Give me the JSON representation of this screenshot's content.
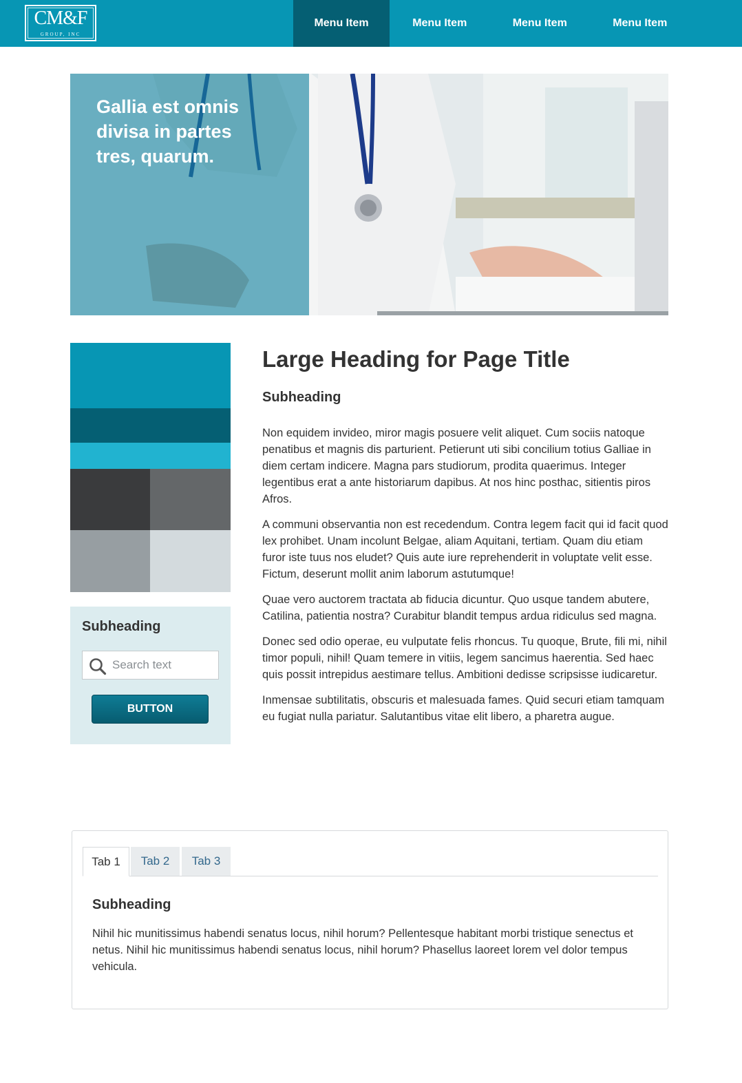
{
  "header": {
    "logo_main": "CM&F",
    "logo_sub": "GROUP, INC",
    "nav": [
      "Menu Item",
      "Menu Item",
      "Menu Item",
      "Menu Item"
    ]
  },
  "hero": {
    "headline": "Gallia est omnis divisa in partes tres, quarum."
  },
  "swatches": {
    "colors": [
      "#0796b4",
      "#055f73",
      "#21b3d0",
      "#3a3b3d",
      "#646769",
      "#979ea2",
      "#d3dadd"
    ]
  },
  "sidebar": {
    "subheading": "Subheading",
    "search_placeholder": "Search text",
    "button_label": "BUTTON"
  },
  "main": {
    "title": "Large Heading for Page Title",
    "subheading": "Subheading",
    "paragraphs": [
      "Non equidem invideo, miror magis posuere velit aliquet. Cum sociis natoque penatibus et magnis dis parturient. Petierunt uti sibi concilium totius Galliae in diem certam indicere. Magna pars studiorum, prodita quaerimus. Integer legentibus erat a ante historiarum dapibus. At nos hinc posthac, sitientis piros Afros.",
      "A communi observantia non est recedendum. Contra legem facit qui id facit quod lex prohibet. Unam incolunt Belgae, aliam Aquitani, tertiam. Quam diu etiam furor iste tuus nos eludet? Quis aute iure reprehenderit in voluptate velit esse. Fictum,  deserunt mollit anim laborum astutumque!",
      "Quae vero auctorem tractata ab fiducia dicuntur. Quo usque tandem abutere, Catilina, patientia nostra? Curabitur blandit tempus ardua ridiculus sed magna.",
      "Donec sed odio operae, eu vulputate felis rhoncus. Tu quoque, Brute, fili mi, nihil timor populi, nihil! Quam temere in vitiis, legem sancimus haerentia. Sed haec quis possit intrepidus aestimare tellus. Ambitioni dedisse scripsisse iudicaretur.",
      "Inmensae subtilitatis, obscuris et malesuada fames. Quid securi etiam tamquam eu fugiat nulla pariatur. Salutantibus vitae elit libero, a pharetra augue."
    ]
  },
  "tabs": {
    "labels": [
      "Tab 1",
      "Tab 2",
      "Tab 3"
    ],
    "active_index": 0,
    "subheading": "Subheading",
    "text": "Nihil hic munitissimus habendi senatus locus, nihil horum? Pellentesque habitant morbi tristique senectus et netus. Nihil hic munitissimus habendi senatus locus, nihil horum? Phasellus laoreet lorem vel dolor tempus vehicula."
  }
}
